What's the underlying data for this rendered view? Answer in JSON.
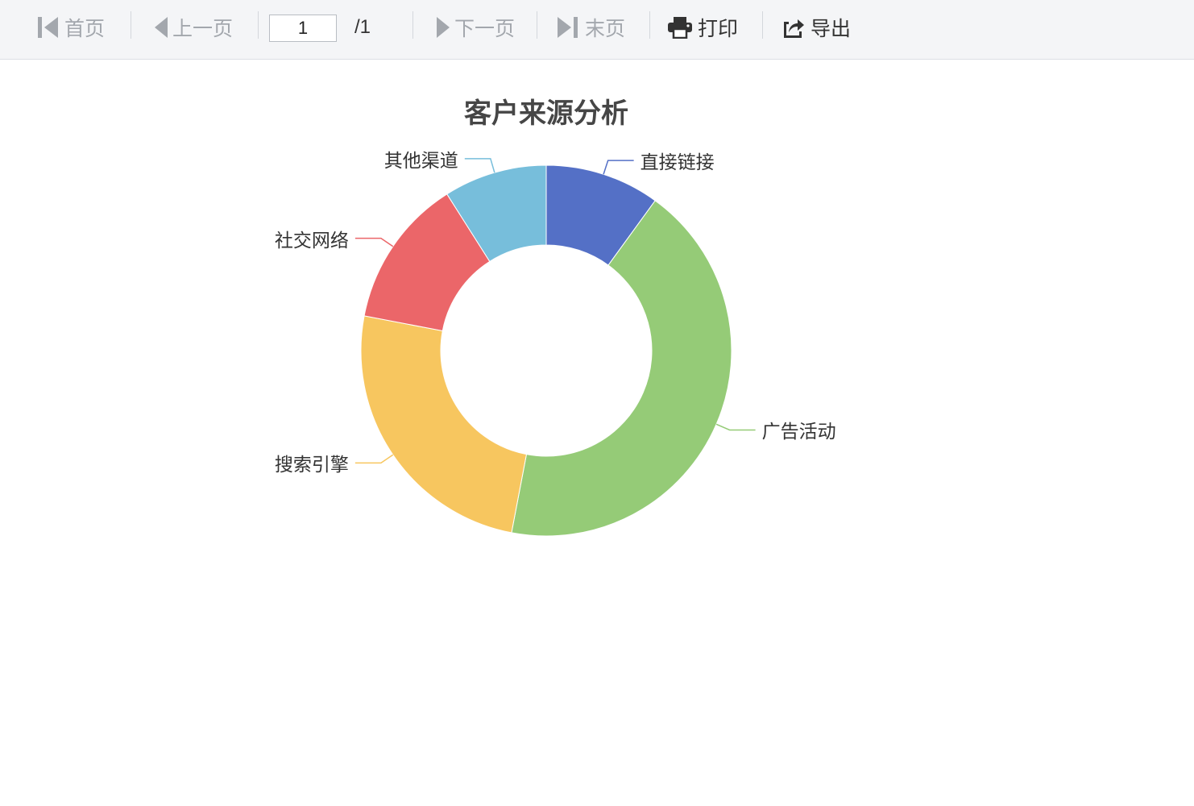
{
  "toolbar": {
    "first": "首页",
    "prev": "上一页",
    "page_value": "1",
    "page_total": "/1",
    "next": "下一页",
    "last": "末页",
    "print": "打印",
    "export": "导出"
  },
  "chart_data": {
    "type": "pie",
    "variant": "donut",
    "title": "客户来源分析",
    "legend": "none",
    "slices": [
      {
        "label": "直接链接",
        "value": 10,
        "color": "#5470c6"
      },
      {
        "label": "广告活动",
        "value": 43,
        "color": "#95cb77"
      },
      {
        "label": "搜索引擎",
        "value": 25,
        "color": "#f7c65f"
      },
      {
        "label": "社交网络",
        "value": 13,
        "color": "#eb6669"
      },
      {
        "label": "其他渠道",
        "value": 9,
        "color": "#77bedb"
      }
    ]
  }
}
